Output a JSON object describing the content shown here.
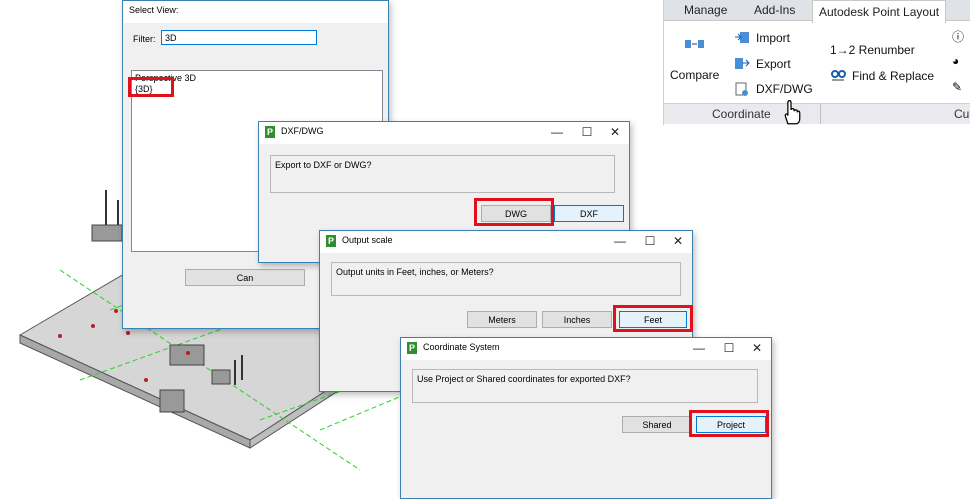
{
  "ribbon": {
    "tabs": [
      "Manage",
      "Add-Ins",
      "Autodesk Point Layout"
    ],
    "compare_label": "Compare",
    "import_label": "Import",
    "export_label": "Export",
    "dxfdwg_label": "DXF/DWG",
    "renumber_label": "1→2 Renumber",
    "find_replace_label": "Find & Replace",
    "panel_label": "Coordinate",
    "panel_label_2": "Cu"
  },
  "select_view": {
    "title": "Select View:",
    "filter_label": "Filter:",
    "filter_value": "3D",
    "items": [
      "Perspective 3D",
      "{3D}"
    ],
    "cancel_label": "Can"
  },
  "dxf_dialog": {
    "title": "DXF/DWG",
    "message": "Export to DXF or DWG?",
    "btn_dwg": "DWG",
    "btn_dxf": "DXF"
  },
  "scale_dialog": {
    "title": "Output scale",
    "message": "Output units in Feet, inches, or Meters?",
    "btn_meters": "Meters",
    "btn_inches": "Inches",
    "btn_feet": "Feet"
  },
  "coord_dialog": {
    "title": "Coordinate System",
    "message": "Use Project or Shared coordinates for exported DXF?",
    "btn_shared": "Shared",
    "btn_project": "Project"
  },
  "window_controls": {
    "minimize": "—",
    "maximize": "☐",
    "close": "✕"
  },
  "colors": {
    "highlight": "#e0111b",
    "accent": "#0078d7",
    "grid": "#2bd12b"
  },
  "icons": [
    "compare-icon",
    "import-icon",
    "export-icon",
    "dxf-icon",
    "find-icon",
    "hand-cursor-icon",
    "p-logo-icon"
  ]
}
